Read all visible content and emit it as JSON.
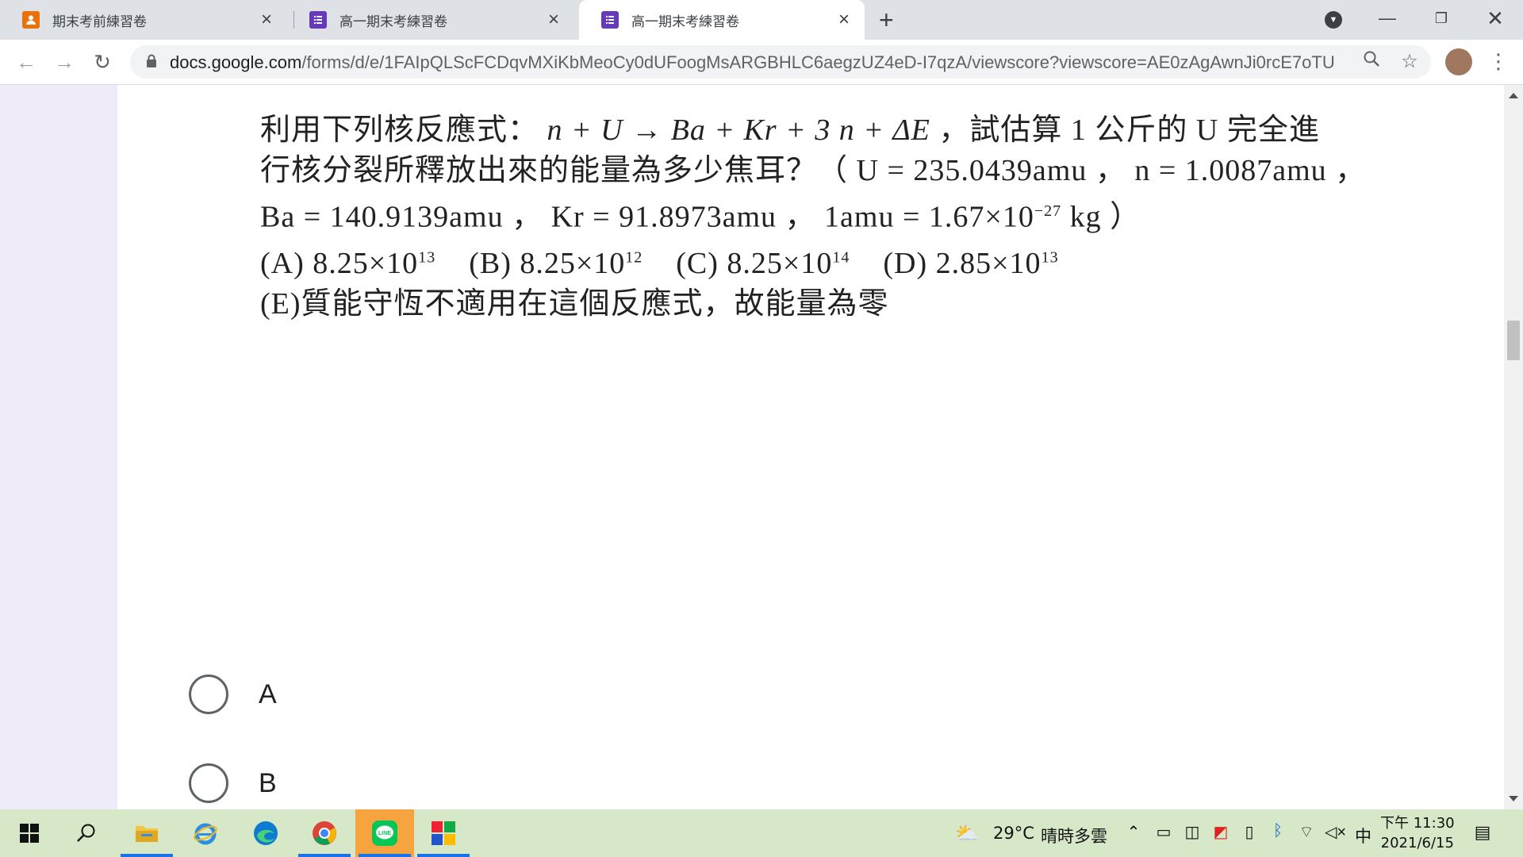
{
  "tabs": [
    {
      "title": "期末考前練習卷",
      "icon": "user-form-icon",
      "color": "#e8710a"
    },
    {
      "title": "高一期末考練習卷",
      "icon": "forms-icon",
      "color": "#673ab7"
    },
    {
      "title": "高一期末考練習卷",
      "icon": "forms-icon",
      "color": "#673ab7"
    }
  ],
  "toolbar": {
    "url_host": "docs.google.com",
    "url_path": "/forms/d/e/1FAIpQLScFCDqvMXiKbMeoCy0dUFoogMsARGBHLC6aegzUZ4eD-I7qzA/viewscore?viewscore=AE0zAgAwnJi0rcE7oTU..."
  },
  "question": {
    "l1_a": "利用下列核反應式：",
    "l1_eq": "n + U → Ba + Kr + 3 n + ΔE",
    "l1_b": "，試估算 1 公斤的",
    "l1_c": "U 完全進",
    "l2_a": "行核分裂所釋放出來的能量為多少焦耳？（",
    "l2_b": "U = 235.0439amu ，",
    "l2_c": "n = 1.0087amu ，",
    "l3_a": "Ba = 140.9139amu ，",
    "l3_b": "Kr = 91.8973amu ， 1amu = 1.67×10",
    "l3_exp": "−27",
    "l3_c": " kg ）",
    "opt_a": "(A) 8.25×10",
    "opt_a_exp": "13",
    "opt_b": "(B) 8.25×10",
    "opt_b_exp": "12",
    "opt_c": "(C) 8.25×10",
    "opt_c_exp": "14",
    "opt_d": "(D) 2.85×10",
    "opt_d_exp": "13",
    "opt_e": "(E)質能守恆不適用在這個反應式，故能量為零"
  },
  "choices": [
    "A",
    "B"
  ],
  "taskbar": {
    "weather_temp": "29°C",
    "weather_text": "晴時多雲",
    "ime": "中",
    "time": "下午 11:30",
    "date": "2021/6/15"
  }
}
